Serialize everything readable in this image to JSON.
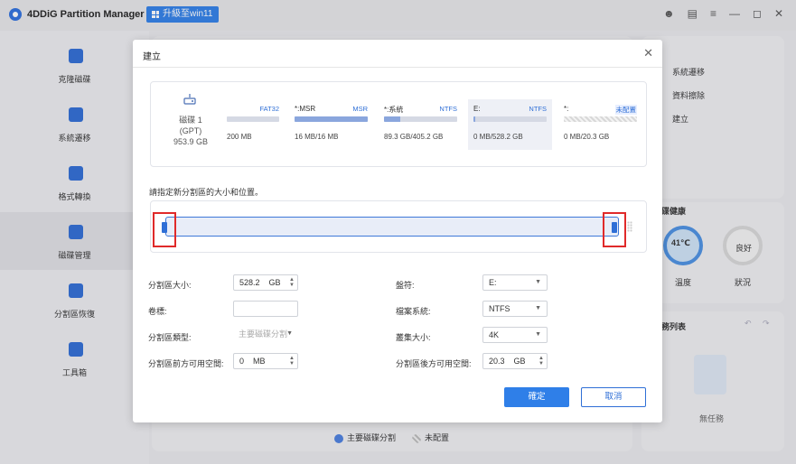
{
  "app": {
    "title": "4DDiG Partition Manager",
    "upgrade_label": "升級至win11"
  },
  "titlebar_icons": [
    "user-icon",
    "message-icon",
    "menu-icon",
    "minimize-icon",
    "maximize-icon",
    "close-icon"
  ],
  "sidebar": {
    "items": [
      {
        "label": "克隆磁碟",
        "icon": "clone-disk-icon"
      },
      {
        "label": "系統遷移",
        "icon": "system-migrate-icon"
      },
      {
        "label": "格式轉換",
        "icon": "format-convert-icon"
      },
      {
        "label": "磁碟管理",
        "icon": "disk-manage-icon",
        "active": true
      },
      {
        "label": "分割區恢復",
        "icon": "partition-recovery-icon"
      },
      {
        "label": "工具箱",
        "icon": "toolbox-icon"
      }
    ]
  },
  "right_panel": {
    "actions": [
      "系統遷移",
      "資料擦除",
      "建立"
    ],
    "health_title": "碟健康",
    "temperature": "41℃",
    "temperature_label": "溫度",
    "status_value": "良好",
    "status_label": "狀況",
    "tasks_title": "務列表",
    "no_task": "無任務"
  },
  "legend": {
    "primary": "主要磁碟分割",
    "unallocated": "未配置"
  },
  "dialog": {
    "title": "建立",
    "disk": {
      "name": "磁碟 1",
      "type": "(GPT)",
      "size": "953.9 GB"
    },
    "partitions": [
      {
        "name": "",
        "fs": "FAT32",
        "size": "200 MB",
        "fill": 0
      },
      {
        "name": "*:MSR",
        "fs": "MSR",
        "size": "16 MB/16 MB",
        "fill": 1.0
      },
      {
        "name": "*:系統",
        "fs": "NTFS",
        "size": "89.3 GB/405.2 GB",
        "fill": 0.22
      },
      {
        "name": "E:",
        "fs": "NTFS",
        "size": "0 MB/528.2 GB",
        "fill": 0.02,
        "selected": true
      },
      {
        "name": "*:",
        "fs": "未配置",
        "size": "0 MB/20.3 GB",
        "fill": 0,
        "unallocated": true
      }
    ],
    "prompt": "請指定新分割區的大小和位置。",
    "form": {
      "size_label": "分割區大小:",
      "size_value": "528.2",
      "size_unit": "GB",
      "volume_label": "卷標:",
      "volume_value": "",
      "ptype_label": "分割區類型:",
      "ptype_value": "主要磁碟分割",
      "before_label": "分割區前方可用空間:",
      "before_value": "0",
      "before_unit": "MB",
      "drive_label": "盤符:",
      "drive_value": "E:",
      "fs_label": "檔案系統:",
      "fs_value": "NTFS",
      "cluster_label": "叢集大小:",
      "cluster_value": "4K",
      "after_label": "分割區後方可用空間:",
      "after_value": "20.3",
      "after_unit": "GB"
    },
    "ok_label": "確定",
    "cancel_label": "取消"
  }
}
